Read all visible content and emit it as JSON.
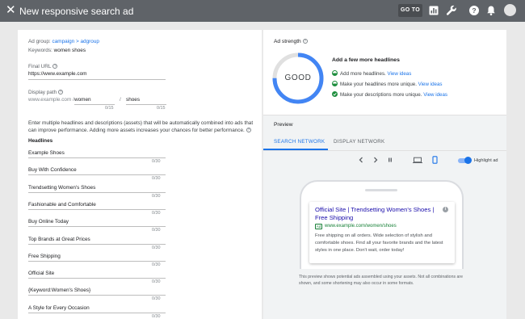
{
  "header": {
    "title": "New responsive search ad",
    "goto_label": "GO TO"
  },
  "form": {
    "ad_group_label": "Ad group:",
    "ad_group_value": "campaign > adgroup",
    "keywords_label": "Keywords:",
    "keywords_value": "women shoes",
    "final_url_label": "Final URL",
    "final_url_value": "https://www.example.com",
    "display_path_label": "Display path",
    "display_path_base": "www.example.com /",
    "path1_value": "women",
    "path_sep": "/",
    "path2_value": "shoes",
    "path1_count": "0/15",
    "path2_count": "0/15",
    "instructions": "Enter multiple headlines and descriptions (assets)  that will be automatically combined into ads that can improve performance. Adding more assets increases your chances for better performance.",
    "headlines_title": "Headlines",
    "headlines": [
      {
        "text": "Example Shoes",
        "count": "0/30"
      },
      {
        "text": "Buy With Confidence",
        "count": "0/30"
      },
      {
        "text": "Trendsetting Women's Shoes",
        "count": "0/30"
      },
      {
        "text": "Fashionable and Comfortable",
        "count": "0/30"
      },
      {
        "text": "Buy Online Today",
        "count": "0/30"
      },
      {
        "text": "Top Brands at Great Prices",
        "count": "0/30"
      },
      {
        "text": "Free Shipping",
        "count": "0/30"
      },
      {
        "text": "Official Site",
        "count": "0/30"
      },
      {
        "text": "{Keyword:Women's Shoes}",
        "count": "0/30"
      },
      {
        "text": "A Style for Every Occasion",
        "count": "0/30"
      }
    ]
  },
  "ad_strength": {
    "label": "Ad strength",
    "rating": "GOOD",
    "level": 0.75,
    "accent_color": "#4285f4",
    "suggestion_heading": "Add a few more headlines",
    "suggestions": [
      {
        "text": "Add more headlines.",
        "link": "View ideas",
        "status": "partial",
        "icon": "half-circle-icon"
      },
      {
        "text": "Make your headlines more unique.",
        "link": "View ideas",
        "status": "partial",
        "icon": "half-circle-icon"
      },
      {
        "text": "Make your descriptions more unique.",
        "link": "View ideas",
        "status": "done",
        "icon": "check-circle-icon"
      }
    ]
  },
  "preview": {
    "label": "Preview",
    "tabs": [
      "SEARCH NETWORK",
      "DISPLAY NETWORK"
    ],
    "active_tab": "SEARCH NETWORK",
    "highlight_label": "Highlight ad",
    "highlight_on": true,
    "device": "mobile",
    "ad": {
      "title": "Official Site | Trendsetting Women's Shoes | Free Shipping",
      "badge": "Ad",
      "url": "www.example.com/women/shoes",
      "description": "Free shipping on all orders. Wide selection of stylish and comfortable shoes. Find all your favorite brands and the latest styles in one place. Don't wait, order today!"
    },
    "disclaimer": "This preview shows potential ads assembled using your assets. Not all combinations are shown, and some shortening may also occur in some formats."
  }
}
